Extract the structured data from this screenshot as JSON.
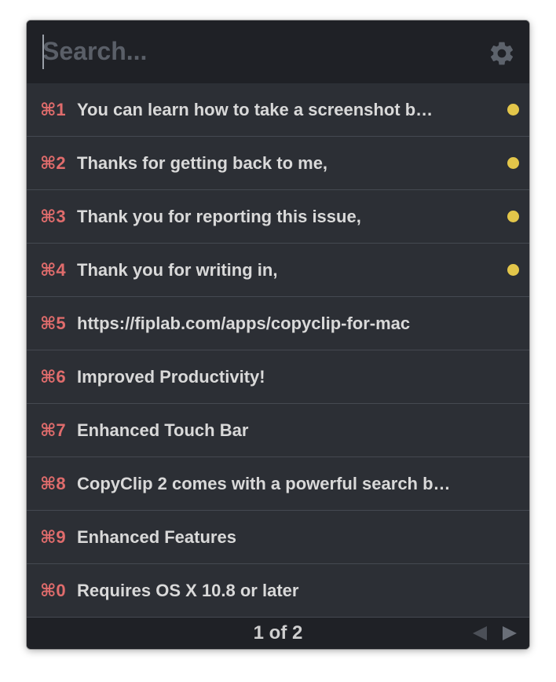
{
  "search": {
    "placeholder": "Search...",
    "value": ""
  },
  "header": {
    "settings_icon": "gear-icon"
  },
  "clips": [
    {
      "shortcut": "⌘1",
      "text": "You can learn how to take a screenshot b…",
      "pinned": true
    },
    {
      "shortcut": "⌘2",
      "text": "Thanks for getting back to me,",
      "pinned": true
    },
    {
      "shortcut": "⌘3",
      "text": "Thank you for reporting this issue,",
      "pinned": true
    },
    {
      "shortcut": "⌘4",
      "text": "Thank you for writing in,",
      "pinned": true
    },
    {
      "shortcut": "⌘5",
      "text": "https://fiplab.com/apps/copyclip-for-mac",
      "pinned": false
    },
    {
      "shortcut": "⌘6",
      "text": "Improved Productivity!",
      "pinned": false
    },
    {
      "shortcut": "⌘7",
      "text": "Enhanced Touch Bar",
      "pinned": false
    },
    {
      "shortcut": "⌘8",
      "text": "CopyClip 2 comes with a powerful search b…",
      "pinned": false
    },
    {
      "shortcut": "⌘9",
      "text": "Enhanced Features",
      "pinned": false
    },
    {
      "shortcut": "⌘0",
      "text": "Requires OS X 10.8 or later",
      "pinned": false
    }
  ],
  "footer": {
    "page_indicator": "1 of 2",
    "prev_icon": "arrow-left-icon",
    "next_icon": "arrow-right-icon"
  },
  "colors": {
    "background": "#2c2f35",
    "header": "#1f2126",
    "shortcut": "#e06c6c",
    "text": "#d9d9d9",
    "pinned_dot": "#e3c64a",
    "divider": "#454951"
  }
}
